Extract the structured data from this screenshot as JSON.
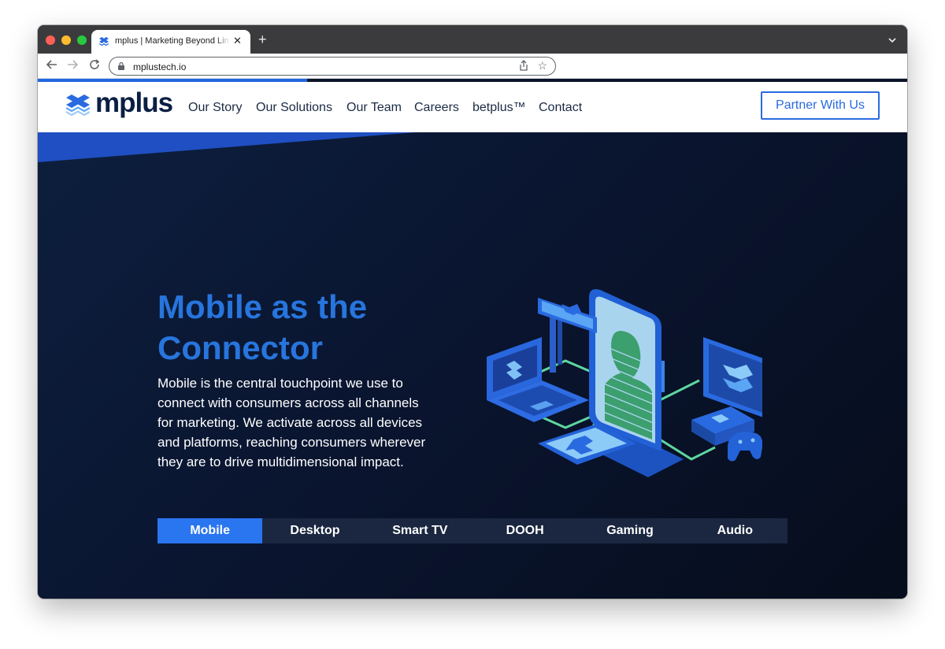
{
  "browser": {
    "tab_title": "mplus | Marketing Beyond Limits",
    "new_tab_symbol": "+",
    "close_symbol": "✕",
    "url": "mplustech.io",
    "page_load_progress": 0.31,
    "icons": [
      "back-arrow-icon",
      "forward-arrow-icon",
      "reload-icon",
      "lock-icon",
      "share-icon",
      "star-icon",
      "tab-search-chevron-icon"
    ]
  },
  "nav": {
    "logo_text": "mplus",
    "items": [
      {
        "label": "Our Story"
      },
      {
        "label": "Our Solutions"
      },
      {
        "label": "Our Team"
      },
      {
        "label": "Careers"
      },
      {
        "label": "betplus™"
      },
      {
        "label": "Contact"
      }
    ],
    "cta_label": "Partner With Us"
  },
  "hero": {
    "title_line1": "Mobile as the",
    "title_line2": "Connector",
    "body": "Mobile is the central touchpoint we use to connect with consumers across all channels for marketing. We activate across all devices and platforms, reaching consumers wherever they are to drive multidimensional impact."
  },
  "channel_tabs": {
    "items": [
      {
        "label": "Mobile",
        "active": true
      },
      {
        "label": "Desktop",
        "active": false
      },
      {
        "label": "Smart TV",
        "active": false
      },
      {
        "label": "DOOH",
        "active": false
      },
      {
        "label": "Gaming",
        "active": false
      },
      {
        "label": "Audio",
        "active": false
      }
    ]
  },
  "colors": {
    "brand_blue": "#2a6ae0",
    "navy": "#0b1f44",
    "hero_bg": "#0a1530",
    "title_blue": "#2775dd",
    "active_tab": "#2a75f0",
    "tab_strip": "#1b2740",
    "connector_green": "#5fd6a0"
  }
}
